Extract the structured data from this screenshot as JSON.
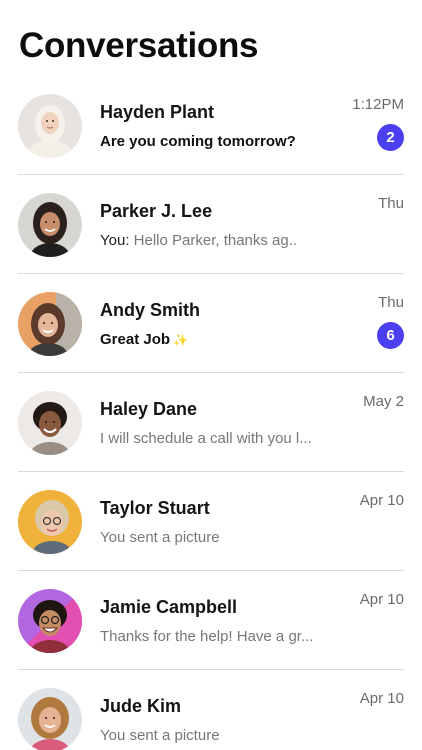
{
  "header": {
    "title": "Conversations"
  },
  "colors": {
    "badge": "#4b3ff2",
    "divider": "#d9d9d9",
    "muted": "#777777"
  },
  "conversations": [
    {
      "name": "Hayden Plant",
      "prefix": "",
      "message": "Are you coming tomorrow?",
      "time": "1:12PM",
      "badge": "2",
      "unread": true,
      "avatar_icon": "person-hijab-avatar"
    },
    {
      "name": "Parker J. Lee",
      "prefix": "You: ",
      "message": "Hello Parker, thanks ag..",
      "time": "Thu",
      "badge": "",
      "unread": false,
      "avatar_icon": "person-dark-hair-avatar"
    },
    {
      "name": "Andy Smith",
      "prefix": "",
      "message": "Great Job",
      "time": "Thu",
      "badge": "6",
      "unread": true,
      "avatar_icon": "person-curly-hair-avatar",
      "emoji": "✨"
    },
    {
      "name": "Haley Dane",
      "prefix": "",
      "message": "I will schedule a call with you l...",
      "time": "May 2",
      "badge": "",
      "unread": false,
      "avatar_icon": "person-short-curly-avatar"
    },
    {
      "name": "Taylor Stuart",
      "prefix": "",
      "message": "You sent a picture",
      "time": "Apr 10",
      "badge": "",
      "unread": false,
      "avatar_icon": "person-glasses-avatar"
    },
    {
      "name": "Jamie Campbell",
      "prefix": "",
      "message": "Thanks for the help! Have a gr...",
      "time": "Apr 10",
      "badge": "",
      "unread": false,
      "avatar_icon": "person-laughing-avatar"
    },
    {
      "name": "Jude Kim",
      "prefix": "",
      "message": "You sent a picture",
      "time": "Apr 10",
      "badge": "",
      "unread": false,
      "avatar_icon": "person-wavy-hair-avatar"
    }
  ]
}
